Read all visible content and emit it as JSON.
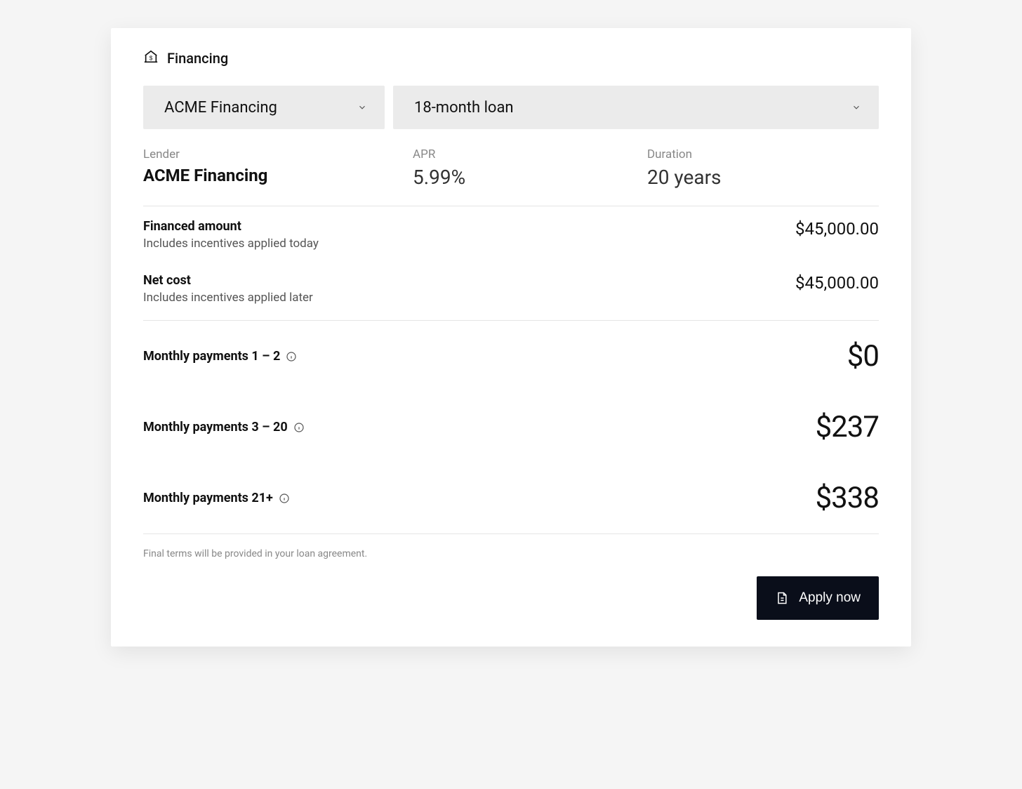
{
  "header": {
    "title": "Financing"
  },
  "dropdowns": {
    "lender": "ACME Financing",
    "term": "18-month loan"
  },
  "summary": {
    "lender_label": "Lender",
    "lender_value": "ACME Financing",
    "apr_label": "APR",
    "apr_value": "5.99%",
    "duration_label": "Duration",
    "duration_value": "20 years"
  },
  "line_items": {
    "financed": {
      "label": "Financed amount",
      "sublabel": "Includes incentives applied today",
      "value": "$45,000.00"
    },
    "net_cost": {
      "label": "Net cost",
      "sublabel": "Includes incentives applied later",
      "value": "$45,000.00"
    }
  },
  "payments": [
    {
      "label": "Monthly payments 1 – 2",
      "value": "$0"
    },
    {
      "label": "Monthly payments 3 – 20",
      "value": "$237"
    },
    {
      "label": "Monthly payments 21+",
      "value": "$338"
    }
  ],
  "disclaimer": "Final terms will be provided in your loan agreement.",
  "apply_button": "Apply now"
}
